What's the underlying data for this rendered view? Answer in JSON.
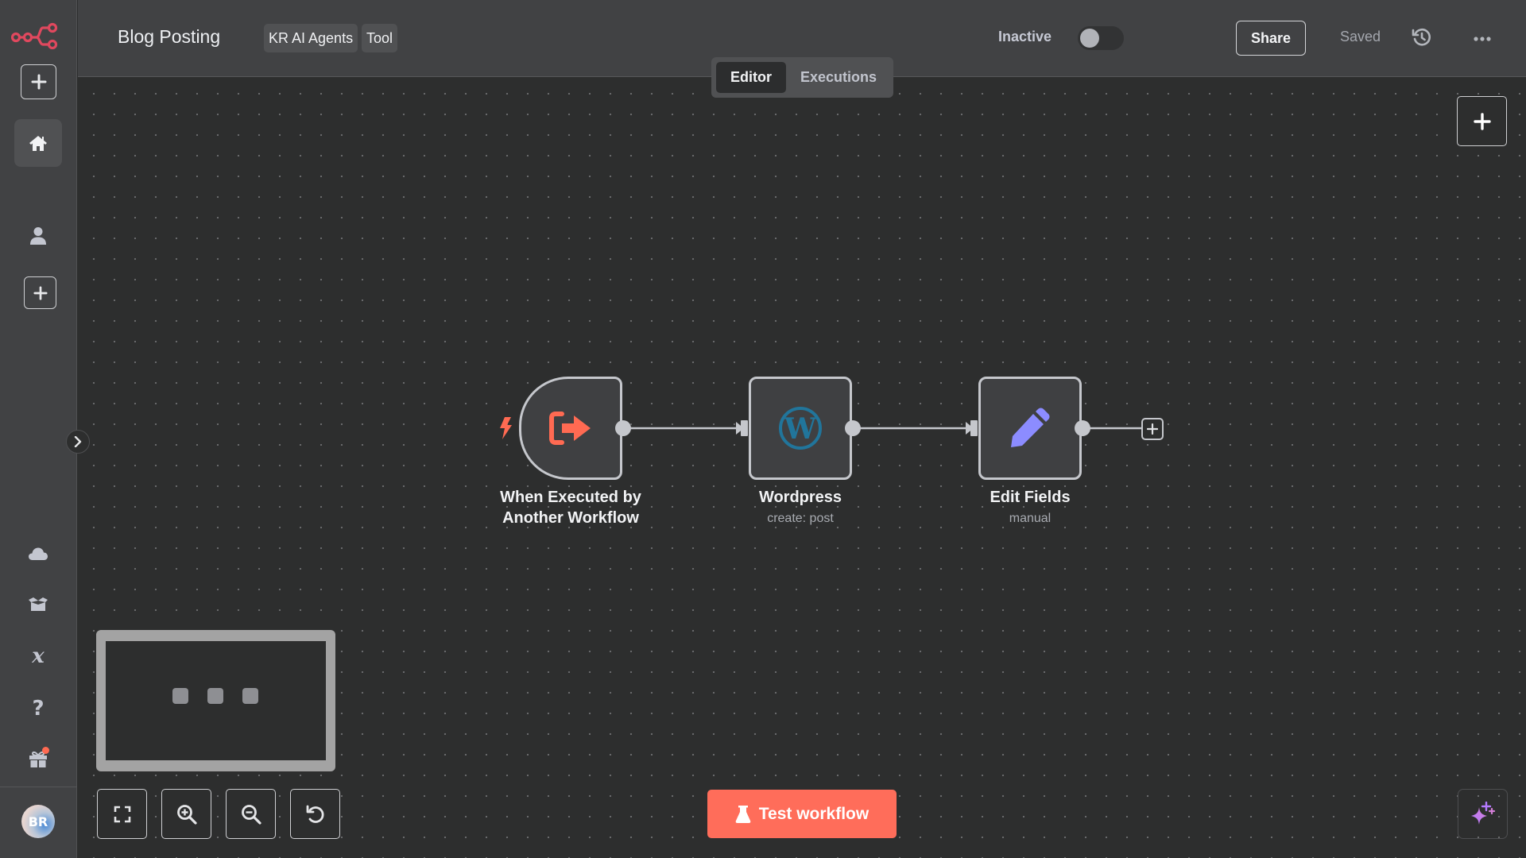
{
  "sidebar": {
    "logo": "n8n-logo-icon",
    "items": [
      {
        "name": "add",
        "icon": "plus-icon"
      },
      {
        "name": "home",
        "icon": "home-icon",
        "active": true
      },
      {
        "name": "personal",
        "icon": "user-icon"
      },
      {
        "name": "add-project",
        "icon": "plus-icon"
      },
      {
        "name": "cloud",
        "icon": "cloud-icon"
      },
      {
        "name": "templates",
        "icon": "box-open-icon"
      },
      {
        "name": "variables",
        "icon": "variable-x-icon"
      },
      {
        "name": "help",
        "icon": "question-icon"
      },
      {
        "name": "whats-new",
        "icon": "gift-icon",
        "has_notification": true
      }
    ],
    "user_initials": "BR",
    "collapse_icon": "chevron-right-icon"
  },
  "header": {
    "title": "Blog Posting",
    "tags": [
      "KR AI Agents",
      "Tool"
    ],
    "active_label": "Inactive",
    "active": false,
    "share_label": "Share",
    "save_status": "Saved",
    "history_icon": "history-icon",
    "more_icon": "more-horizontal-icon"
  },
  "view_switch": {
    "tabs": [
      {
        "label": "Editor",
        "active": true
      },
      {
        "label": "Executions",
        "active": false
      }
    ]
  },
  "canvas": {
    "nodes": [
      {
        "title_line1": "When Executed by",
        "title_line2": "Another Workflow",
        "subtitle": "",
        "icon": "sign-out-arrow-icon",
        "icon_color": "#ff6a52",
        "is_trigger": true
      },
      {
        "title_line1": "Wordpress",
        "subtitle": "create: post",
        "icon": "wordpress-icon",
        "icon_color": "#21759b"
      },
      {
        "title_line1": "Edit Fields",
        "subtitle": "manual",
        "icon": "pencil-icon",
        "icon_color": "#8c8cff"
      }
    ],
    "test_button_label": "Test workflow",
    "colors": {
      "accent": "#ff6d5a",
      "node_border": "#c5c7cc",
      "node_bg": "#3f4042",
      "canvas_bg": "#2d2e2e"
    }
  }
}
